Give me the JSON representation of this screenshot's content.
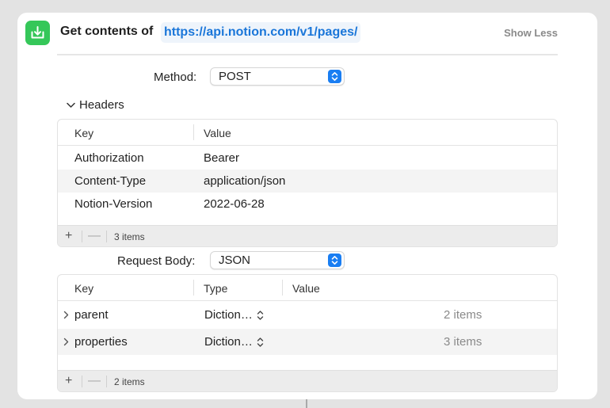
{
  "header": {
    "title": "Get contents of",
    "url": "https://api.notion.com/v1/pages/",
    "show_less": "Show Less"
  },
  "method": {
    "label": "Method:",
    "value": "POST"
  },
  "headers_section": {
    "label": "Headers",
    "columns": [
      "Key",
      "Value"
    ],
    "rows": [
      {
        "key": "Authorization",
        "value": "Bearer"
      },
      {
        "key": "Content-Type",
        "value": "application/json"
      },
      {
        "key": "Notion-Version",
        "value": "2022-06-28"
      }
    ],
    "footer": {
      "add": "+",
      "remove": "—",
      "count": "3 items"
    }
  },
  "request_body": {
    "label": "Request Body:",
    "value": "JSON"
  },
  "body_table": {
    "columns": [
      "Key",
      "Type",
      "Value"
    ],
    "rows": [
      {
        "key": "parent",
        "type": "Diction…",
        "value": "2 items"
      },
      {
        "key": "properties",
        "type": "Diction…",
        "value": "3 items"
      }
    ],
    "footer": {
      "add": "+",
      "remove": "—",
      "count": "2 items"
    }
  },
  "colors": {
    "accent": "#1a7ef2",
    "url_text": "#1a76d9",
    "app_icon": "#35c759"
  },
  "icons": {
    "app": "download-tray-icon",
    "stepper": "up-down-chevron-icon",
    "disclosure": "chevron-down-icon",
    "row_expand": "chevron-right-icon"
  }
}
